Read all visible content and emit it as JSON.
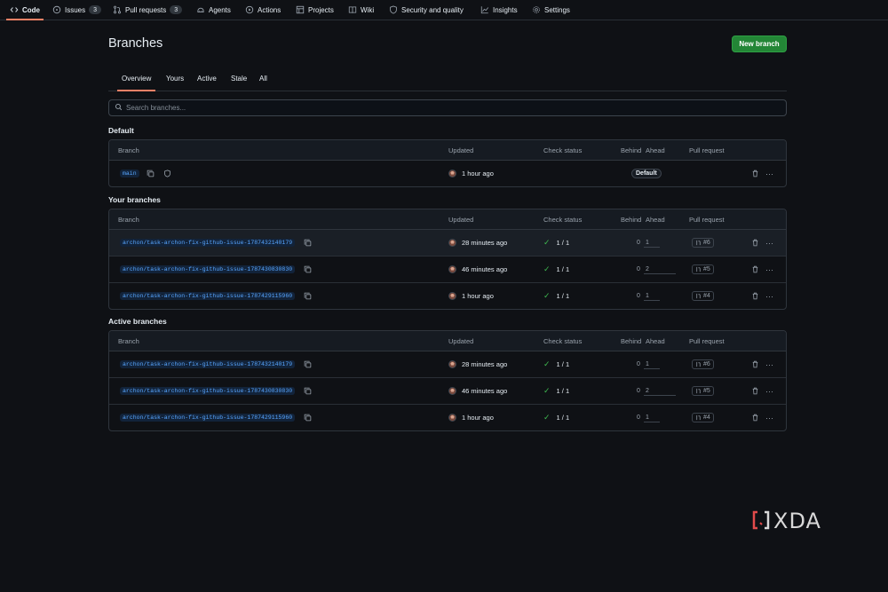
{
  "nav": {
    "tabs": [
      {
        "label": "Code",
        "icon": "code-icon",
        "active": true
      },
      {
        "label": "Issues",
        "icon": "issue-icon",
        "count": "3"
      },
      {
        "label": "Pull requests",
        "icon": "pull-request-icon",
        "count": "3"
      },
      {
        "label": "Agents",
        "icon": "agent-icon"
      },
      {
        "label": "Actions",
        "icon": "play-icon"
      },
      {
        "label": "Projects",
        "icon": "table-icon"
      },
      {
        "label": "Wiki",
        "icon": "book-icon"
      },
      {
        "label": "Security and quality",
        "icon": "shield-icon"
      },
      {
        "label": "Insights",
        "icon": "graph-icon"
      },
      {
        "label": "Settings",
        "icon": "gear-icon"
      }
    ]
  },
  "page": {
    "title": "Branches",
    "new_branch_label": "New branch"
  },
  "subtabs": [
    "Overview",
    "Yours",
    "Active",
    "Stale",
    "All"
  ],
  "search": {
    "placeholder": "Search branches..."
  },
  "columns": {
    "branch": "Branch",
    "updated": "Updated",
    "check_status": "Check status",
    "behind": "Behind",
    "ahead": "Ahead",
    "pull_request": "Pull request"
  },
  "sections": {
    "default": {
      "title": "Default",
      "rows": [
        {
          "branch": "main",
          "updated": "1 hour ago",
          "badge": "Default"
        }
      ]
    },
    "yours": {
      "title": "Your branches",
      "rows": [
        {
          "branch": "archon/task-archon-fix-github-issue-1787432140179",
          "updated": "28 minutes ago",
          "check": "1 / 1",
          "behind": "0",
          "ahead": "1",
          "pr": "#6",
          "ahead_fraction": 0.5
        },
        {
          "branch": "archon/task-archon-fix-github-issue-1787430830830",
          "updated": "46 minutes ago",
          "check": "1 / 1",
          "behind": "0",
          "ahead": "2",
          "pr": "#5",
          "ahead_fraction": 1.0
        },
        {
          "branch": "archon/task-archon-fix-github-issue-1787429115960",
          "updated": "1 hour ago",
          "check": "1 / 1",
          "behind": "0",
          "ahead": "1",
          "pr": "#4",
          "ahead_fraction": 0.5
        }
      ]
    },
    "active": {
      "title": "Active branches",
      "rows": [
        {
          "branch": "archon/task-archon-fix-github-issue-1787432140179",
          "updated": "28 minutes ago",
          "check": "1 / 1",
          "behind": "0",
          "ahead": "1",
          "pr": "#6",
          "ahead_fraction": 0.5
        },
        {
          "branch": "archon/task-archon-fix-github-issue-1787430830830",
          "updated": "46 minutes ago",
          "check": "1 / 1",
          "behind": "0",
          "ahead": "2",
          "pr": "#5",
          "ahead_fraction": 1.0
        },
        {
          "branch": "archon/task-archon-fix-github-issue-1787429115960",
          "updated": "1 hour ago",
          "check": "1 / 1",
          "behind": "0",
          "ahead": "1",
          "pr": "#4",
          "ahead_fraction": 0.5
        }
      ]
    }
  },
  "watermark": {
    "text": "XDA",
    "logo_icon": "xda-bracket-icon"
  },
  "colors": {
    "accent": "#f78166",
    "primary_button": "#238636",
    "link": "#58a6ff",
    "success": "#3fb950",
    "background": "#0f1115"
  }
}
